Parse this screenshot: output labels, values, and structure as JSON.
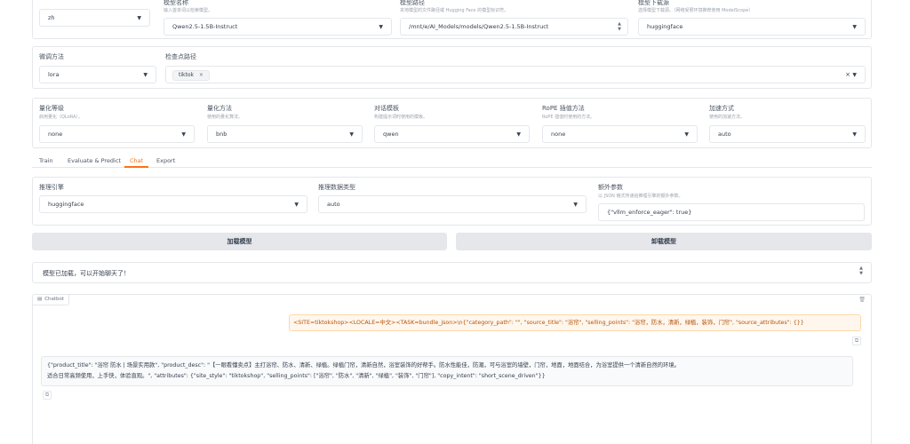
{
  "top_row": {
    "lang": {
      "value": "zh"
    },
    "model_name": {
      "label": "模型名称",
      "hint": "输入首单词以检索模型。",
      "value": "Qwen2.5-1.5B-Instruct"
    },
    "model_path": {
      "label": "模型路径",
      "hint": "本地模型的文件路径或 Hugging Face 的模型标识符。",
      "value": "/mnt/e/AI_Models/models/Qwen2.5-1.5B-Instruct"
    },
    "hub": {
      "label": "模型下载源",
      "hint": "选择模型下载源。（网络受限环境推荐使用 ModelScope）",
      "value": "huggingface"
    }
  },
  "row2": {
    "finetune": {
      "label": "微调方法",
      "value": "lora"
    },
    "checkpoint": {
      "label": "检查点路径",
      "tag": "tiktok",
      "tag_close": "×",
      "clear": "×"
    }
  },
  "row3": {
    "quant_bit": {
      "label": "量化等级",
      "hint": "启用量化（QLoRA）。",
      "value": "none"
    },
    "quant_method": {
      "label": "量化方法",
      "hint": "使用的量化算法。",
      "value": "bnb"
    },
    "template": {
      "label": "对话模板",
      "hint": "构建提示词时使用的模板。",
      "value": "qwen"
    },
    "rope": {
      "label": "RoPE 插值方法",
      "hint": "RoPE 插值时使用的方法。",
      "value": "none"
    },
    "booster": {
      "label": "加速方式",
      "hint": "使用的加速方法。",
      "value": "auto"
    }
  },
  "tabs": [
    "Train",
    "Evaluate & Predict",
    "Chat",
    "Export"
  ],
  "active_tab": "Chat",
  "infer": {
    "backend": {
      "label": "推理引擎",
      "value": "huggingface"
    },
    "dtype": {
      "label": "推理数据类型",
      "value": "auto"
    },
    "extra": {
      "label": "额外参数",
      "hint": "以 JSON 格式传递给推理引擎的额外参数。",
      "value": "{\"vllm_enforce_eager\": true}"
    }
  },
  "buttons": {
    "load": "加载模型",
    "unload": "卸载模型"
  },
  "status": "模型已加载，可以开始聊天了！",
  "chatbot": {
    "label": "Chatbot",
    "user_msg": "<SITE=tiktokshop><LOCALE=中文><TASK=bundle_json>\\n{\"category_path\": \"\", \"source_title\": \"浴帘\", \"selling_points\": \"浴帘，防水，清新，绿植，装饰，门帘\", \"source_attributes\": {}}",
    "bot_line1": "{\"product_title\": \"浴帘 防水 | 场景实用款\", \"product_desc\": \"【一眼看懂卖点】主打浴帘、防水、清新、绿植。绿植门帘，清新自然，浴室装饰的好帮手。防水性能佳，防潮，可与浴室的墙壁，门帘，地面，地面结合，为浴室提供一个清新自然的环境。",
    "bot_line2": "适合日常高频使用，上手快，体验直观。\", \"attributes\": {\"site_style\": \"tiktokshop\", \"selling_points\": [\"浴帘\", \"防水\", \"清新\", \"绿植\", \"装饰\", \"门帘\"], \"copy_intent\": \"short_scene_driven\"}}"
  },
  "colors": {
    "accent": "#f97316",
    "user_bubble_bg": "#fff7ed",
    "user_bubble_border": "#fed7aa"
  }
}
